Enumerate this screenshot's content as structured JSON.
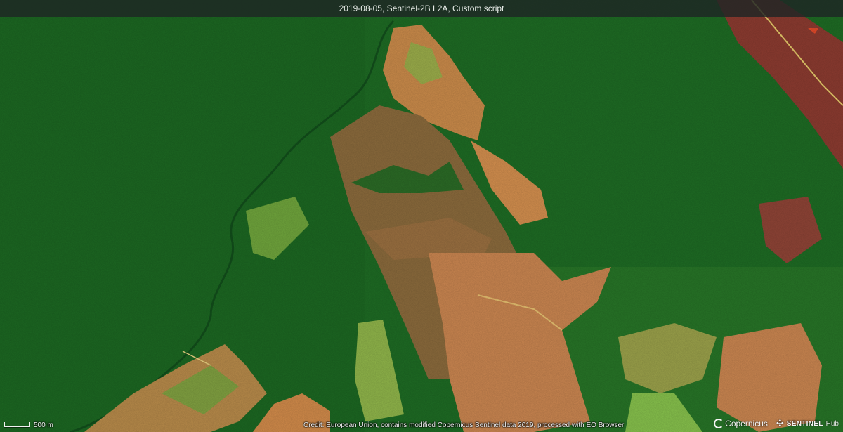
{
  "map": {
    "title": "2019-08-05, Sentinel-2B L2A, Custom script",
    "scale_label": "500 m",
    "credit": "Credit: European Union, contains modified Copernicus Sentinel data 2019, processed with EO Browser",
    "logos": {
      "copernicus": "Copernicus",
      "sentinel_brand": "SENTINEL",
      "sentinel_suffix": "Hub"
    },
    "colors": {
      "forest": "#1e6b24",
      "cleared_land": "#c98a4a",
      "burned_area": "#8b3b30",
      "regrowth": "#6fb43f"
    }
  }
}
